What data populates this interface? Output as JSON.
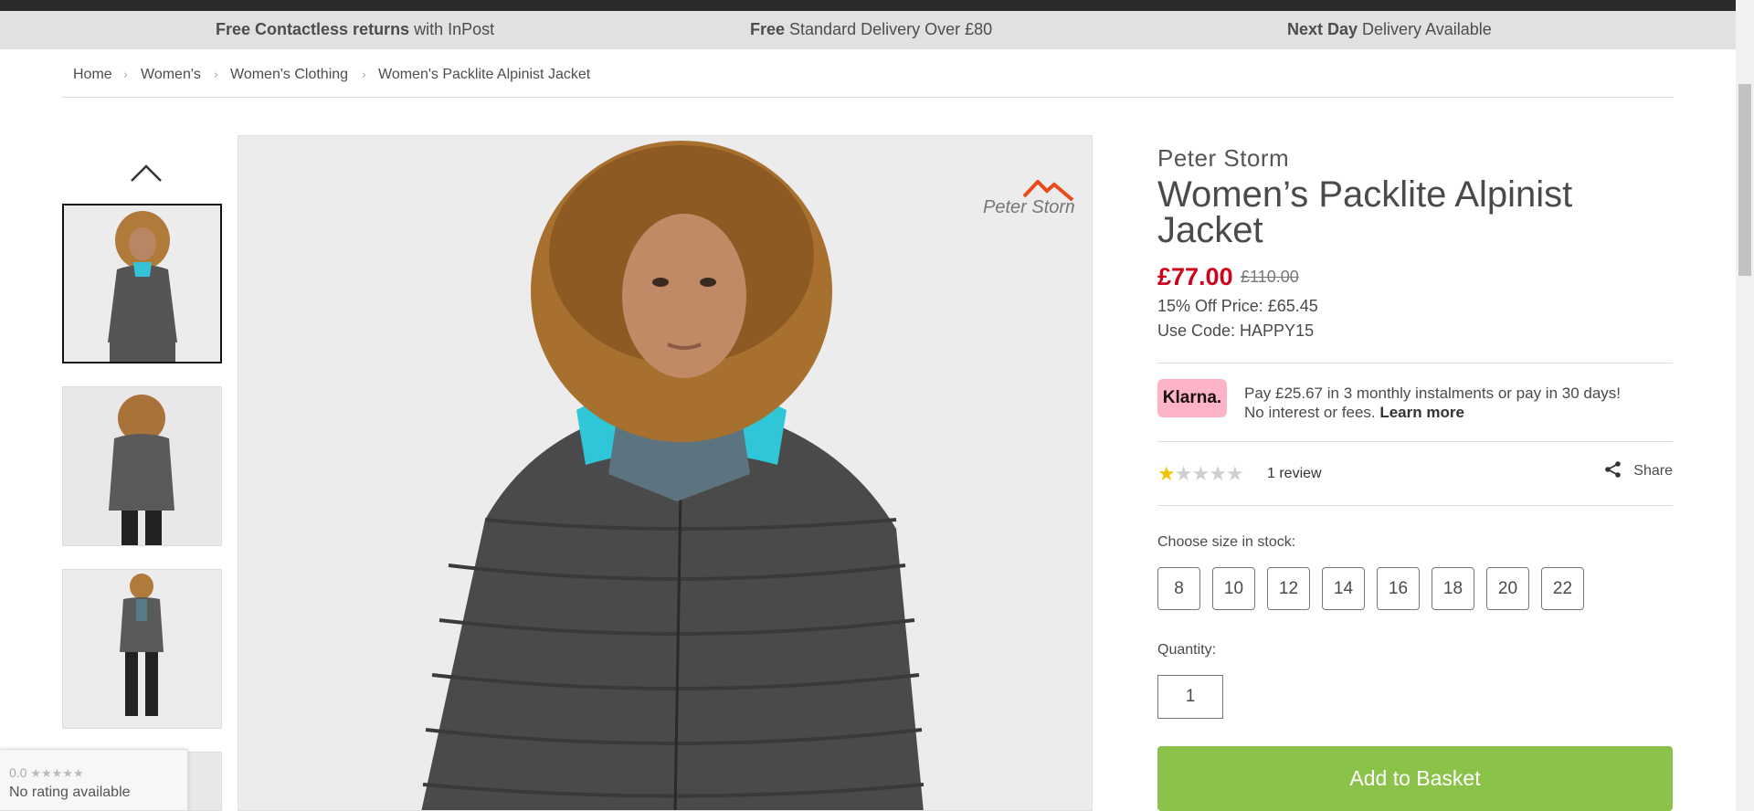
{
  "promo_bar": {
    "items": [
      {
        "bold": "Free Contactless returns",
        "rest": " with InPost"
      },
      {
        "bold": "Free",
        "rest": " Standard Delivery Over £80"
      },
      {
        "bold": "Next Day",
        "rest": " Delivery Available"
      }
    ]
  },
  "breadcrumb": {
    "items": [
      "Home",
      "Women's",
      "Women's Clothing",
      "Women's Packlite Alpinist Jacket"
    ],
    "separator": "›"
  },
  "gallery": {
    "watermark": "Peter Storm"
  },
  "rating_widget": {
    "score": "0.0",
    "text": "No rating available"
  },
  "product": {
    "brand": "Peter Storm",
    "title": "Women’s Packlite Alpinist Jacket",
    "price": "£77.00",
    "was_price": "£110.00",
    "offer_text": "15% Off Price: £65.45",
    "code_text": "Use Code: HAPPY15",
    "klarna": {
      "badge": "Klarna.",
      "line1": "Pay £25.67 in 3 monthly instalments or pay in 30 days!",
      "line2": "No interest or fees. ",
      "learn_more": "Learn more"
    },
    "rating": {
      "value": 1,
      "max": 5
    },
    "review_count": "1 review",
    "share_label": "Share",
    "size_label": "Choose size in stock:",
    "sizes": [
      "8",
      "10",
      "12",
      "14",
      "16",
      "18",
      "20",
      "22"
    ],
    "quantity_label": "Quantity:",
    "quantity": "1",
    "add_to_basket": "Add to Basket"
  },
  "colors": {
    "price": "#d0021b",
    "basket": "#8bc34a",
    "klarna": "#ffb3c7",
    "star": "#f0c40a"
  }
}
